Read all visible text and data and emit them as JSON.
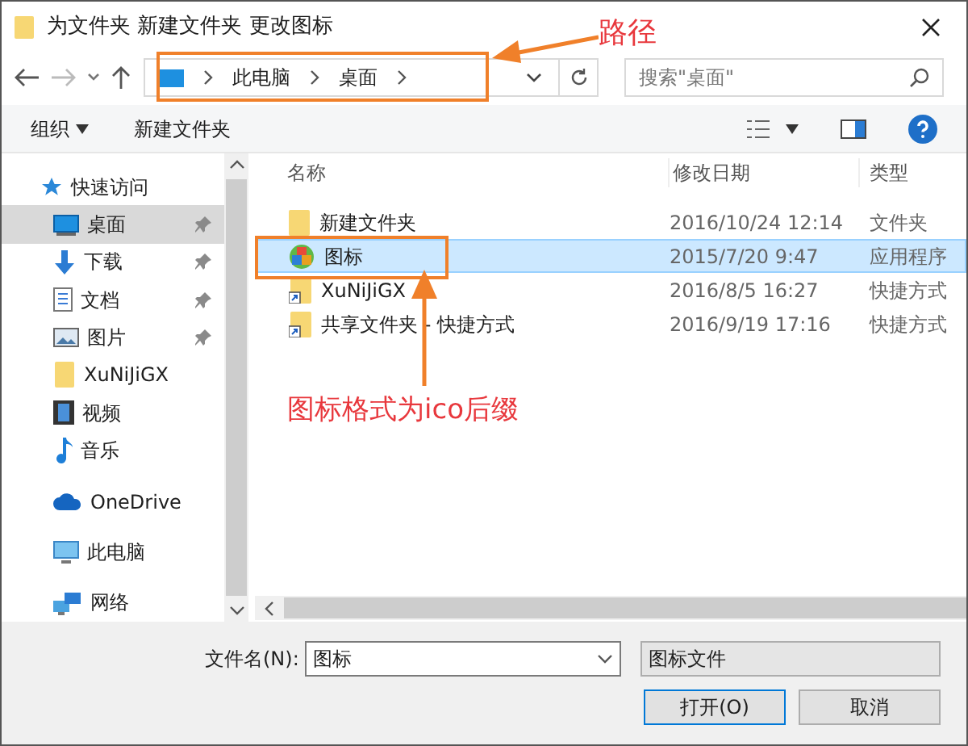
{
  "window": {
    "title": "为文件夹 新建文件夹 更改图标"
  },
  "address": {
    "crumbs": [
      "此电脑",
      "桌面"
    ],
    "search_placeholder": "搜索\"桌面\""
  },
  "toolbar": {
    "organize": "组织",
    "new_folder": "新建文件夹"
  },
  "sidebar": {
    "items": [
      {
        "label": "快速访问",
        "kind": "star",
        "pinned": false,
        "selected": false
      },
      {
        "label": "桌面",
        "kind": "desktop",
        "pinned": true,
        "selected": true
      },
      {
        "label": "下载",
        "kind": "download",
        "pinned": true,
        "selected": false
      },
      {
        "label": "文档",
        "kind": "document",
        "pinned": true,
        "selected": false
      },
      {
        "label": "图片",
        "kind": "picture",
        "pinned": true,
        "selected": false
      },
      {
        "label": "XuNiJiGX",
        "kind": "folder",
        "pinned": false,
        "selected": false
      },
      {
        "label": "视频",
        "kind": "video",
        "pinned": false,
        "selected": false
      },
      {
        "label": "音乐",
        "kind": "music",
        "pinned": false,
        "selected": false
      },
      {
        "label": "OneDrive",
        "kind": "cloud",
        "pinned": false,
        "selected": false
      },
      {
        "label": "此电脑",
        "kind": "pc",
        "pinned": false,
        "selected": false
      },
      {
        "label": "网络",
        "kind": "network",
        "pinned": false,
        "selected": false
      }
    ]
  },
  "table": {
    "columns": [
      "名称",
      "修改日期",
      "类型"
    ],
    "rows": [
      {
        "name": "新建文件夹",
        "date": "2016/10/24 12:14",
        "type": "文件夹",
        "kind": "folder",
        "selected": false
      },
      {
        "name": "图标",
        "date": "2015/7/20 9:47",
        "type": "应用程序",
        "kind": "app",
        "selected": true
      },
      {
        "name": "XuNiJiGX",
        "date": "2016/8/5 16:27",
        "type": "快捷方式",
        "kind": "shortcut",
        "selected": false
      },
      {
        "name": "共享文件夹 - 快捷方式",
        "date": "2016/9/19 17:16",
        "type": "快捷方式",
        "kind": "shortcut",
        "selected": false
      }
    ]
  },
  "footer": {
    "filename_label": "文件名(N):",
    "filename": "图标",
    "filter": "图标文件",
    "buttons": [
      "打开(O)",
      "取消"
    ]
  },
  "annotations": {
    "path_label": "路径",
    "icon_label": "图标格式为ico后缀"
  }
}
